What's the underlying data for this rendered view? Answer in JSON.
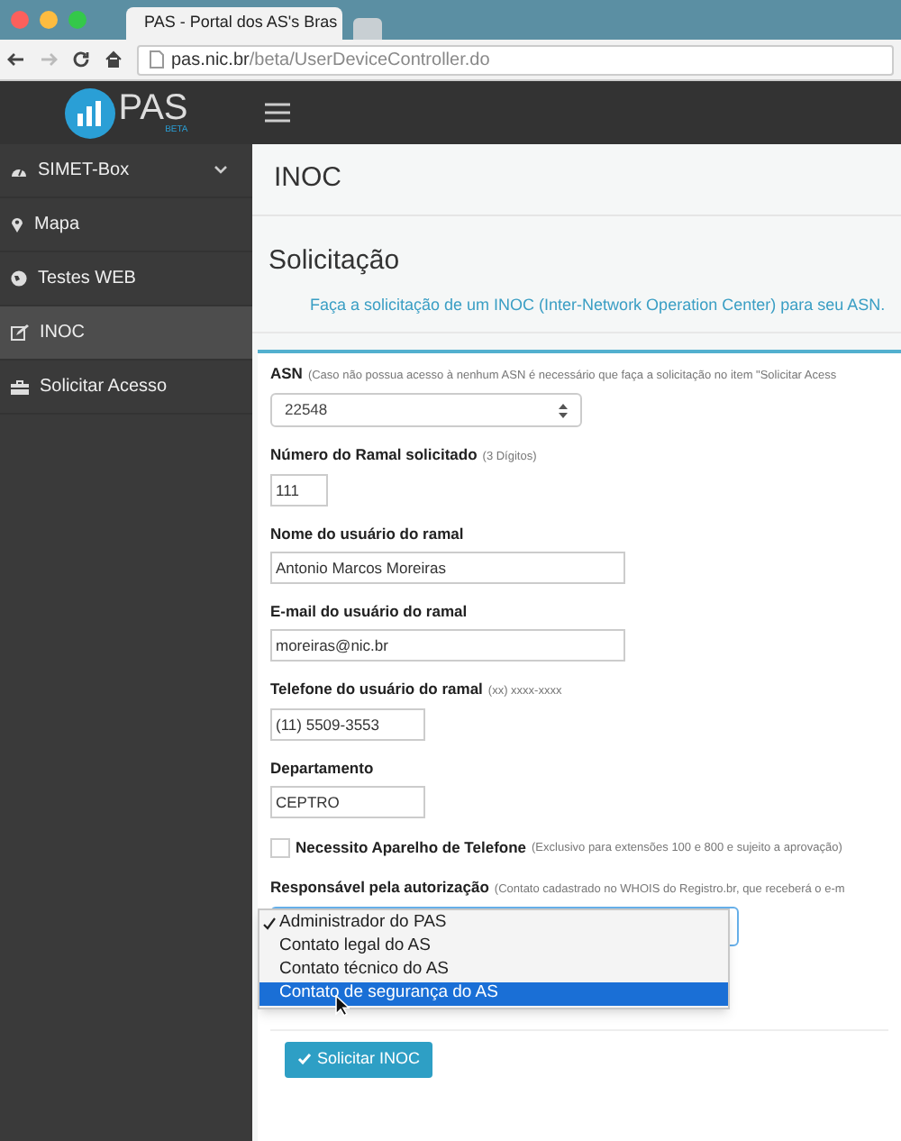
{
  "browser": {
    "tab_title": "PAS - Portal dos AS's Bras",
    "url_host": "pas.nic.br",
    "url_path": "/beta/UserDeviceController.do"
  },
  "app": {
    "logo_text": "PAS",
    "logo_badge": "BETA"
  },
  "sidebar": {
    "items": [
      {
        "label": "SIMET-Box",
        "kind": "group",
        "selected": false
      },
      {
        "label": "Mapa",
        "kind": "link",
        "selected": false
      },
      {
        "label": "Testes WEB",
        "kind": "link",
        "selected": false
      },
      {
        "label": "INOC",
        "kind": "link",
        "selected": true
      },
      {
        "label": "Solicitar Acesso",
        "kind": "link",
        "selected": false
      }
    ]
  },
  "page_title": "INOC",
  "section_title": "Solicitação",
  "intro": "Faça a solicitação de um INOC (Inter-Network Operation Center) para seu ASN.",
  "form": {
    "fields": [
      {
        "kind": "select",
        "label": "ASN",
        "hint": "(Caso não possua acesso à nenhum ASN é necessário que faça a solicitação no item \"Solicitar Acess",
        "value": "22548"
      },
      {
        "kind": "text",
        "label": "Número do Ramal solicitado",
        "hint": "(3 Dígitos)",
        "value": "111"
      },
      {
        "kind": "text",
        "label": "Nome do usuário do ramal",
        "value": "Antonio Marcos Moreiras"
      },
      {
        "kind": "text",
        "label": "E-mail do usuário do ramal",
        "value": "moreiras@nic.br"
      },
      {
        "kind": "text",
        "label": "Telefone do usuário do ramal",
        "hint": "(xx) xxxx-xxxx",
        "value": "(11) 5509-3553"
      },
      {
        "kind": "text",
        "label": "Departamento",
        "value": "CEPTRO"
      },
      {
        "kind": "checkbox",
        "label": "Necessito Aparelho de Telefone",
        "hint": "(Exclusivo para extensões 100 e 800 e sujeito a aprovação)",
        "checked": false
      },
      {
        "kind": "dropdown",
        "label": "Responsável pela autorização",
        "hint": "(Contato cadastrado no WHOIS do Registro.br, que receberá o e-m",
        "options": [
          {
            "label": "Administrador do PAS",
            "selected": true,
            "highlighted": false
          },
          {
            "label": "Contato legal do AS",
            "selected": false,
            "highlighted": false
          },
          {
            "label": "Contato técnico do AS",
            "selected": false,
            "highlighted": false
          },
          {
            "label": "Contato de segurança do AS",
            "selected": false,
            "highlighted": true
          }
        ]
      }
    ],
    "submit": "Solicitar INOC"
  }
}
